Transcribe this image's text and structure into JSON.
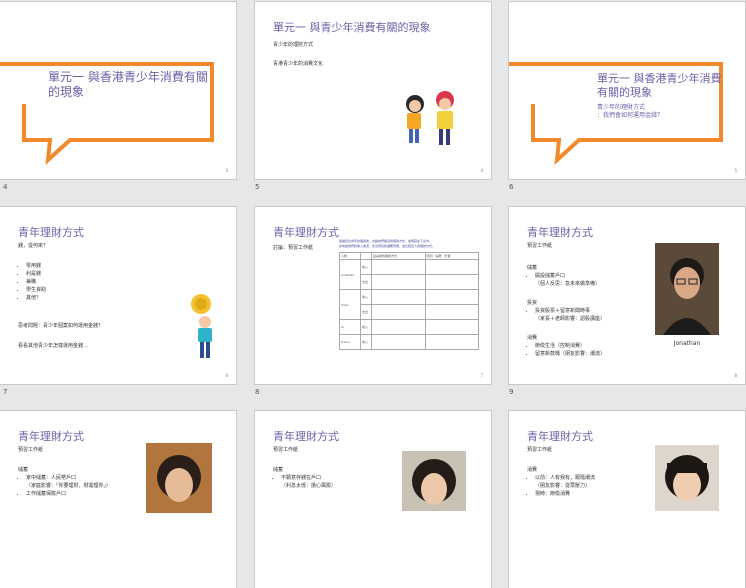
{
  "slides": [
    {
      "num": "4",
      "title": "單元一 與香港青少年消費有關的現象",
      "page": "3"
    },
    {
      "num": "5",
      "title": "單元一 與青少年消費有關的現象",
      "lines": [
        "青少年的理財方式",
        "青港青少年的消費文化"
      ],
      "page": "4"
    },
    {
      "num": "6",
      "title": "單元一 與香港青少年消費有關的現象",
      "sub": [
        "青少年的理財方式",
        "：我們會如何運用金錢？"
      ],
      "page": "5"
    },
    {
      "num": "7",
      "title": "青年理財方式",
      "q": "錢，從何來？",
      "bullets": [
        "零用錢",
        "利是錢",
        "兼職",
        "學生資助",
        "其他？"
      ],
      "lines": [
        "思考問題：青少年個案如何運用金錢？",
        "看看其他青少年怎樣運用金錢…"
      ],
      "page": "6"
    },
    {
      "num": "8",
      "title": "青年理財方式",
      "discuss": "討論：預習工作紙",
      "intro": [
        "閱讀四位青年的個案後，討論他們各自的理財方式，並填寫在下表中。",
        "請考慮他們的收入來源、支出項目和儲蓄習慣，並比較四人的理財方式。"
      ],
      "headers": [
        "人物",
        "",
        "最喜歡的理財方式",
        "原因／得著／影響"
      ],
      "people": [
        "Jonathan",
        "Vicky",
        "Ai",
        "Tracie"
      ],
      "types": [
        "收入",
        "支出"
      ],
      "page": "7"
    },
    {
      "num": "9",
      "title": "青年理財方式",
      "ws": "預習工作紙",
      "sec": [
        {
          "h": "儲蓄",
          "b": [
            "開設儲蓄戶口",
            "（個人反思：急未來做準備）"
          ]
        },
        {
          "h": "投資",
          "b": [
            "投資股票＋留意新聞時事",
            "（家長＋老師影響：認股講座）"
          ]
        },
        {
          "h": "消費",
          "b": [
            "節儉生活（控制消費）",
            "留意新款機（朋友影響：潮流）"
          ]
        }
      ],
      "caption": "Jonathan",
      "page": "8"
    },
    {
      "num": "10",
      "title": "青年理財方式",
      "ws": "預習工作紙",
      "sec": [
        {
          "h": "儲蓄",
          "b": [
            "家中儲蓄：人民幣戶口",
            "（家庭影響：「你要理財，財需理你」）",
            "工作儲蓄保險戶口"
          ]
        }
      ]
    },
    {
      "num": "11",
      "title": "青年理財方式",
      "ws": "預習工作紙",
      "sec": [
        {
          "h": "儲蓄",
          "b": [
            "不願意存錢在戶口",
            "（利息太低：擔心風險）"
          ]
        }
      ]
    },
    {
      "num": "12",
      "title": "青年理財方式",
      "ws": "預習工作紙",
      "sec": [
        {
          "h": "消費",
          "b": [
            "以前：人有我有，跟隨潮流",
            "（朋友影響：從眾壓力）",
            "現時：節儉消費"
          ]
        }
      ]
    }
  ]
}
